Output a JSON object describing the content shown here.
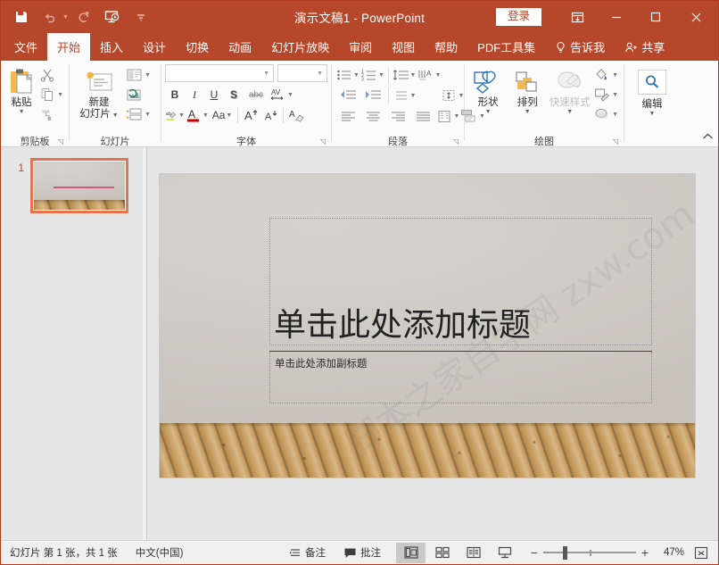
{
  "titlebar": {
    "document_title": "演示文稿1",
    "app_name": "PowerPoint",
    "title_full": "演示文稿1 - PowerPoint",
    "signin_label": "登录",
    "brand_color": "#b7472a",
    "quick_access": [
      {
        "name": "save-icon",
        "label": "保存",
        "disabled": false
      },
      {
        "name": "undo-icon",
        "label": "撤消",
        "disabled": true
      },
      {
        "name": "redo-icon",
        "label": "恢复",
        "disabled": true
      },
      {
        "name": "start-slideshow-icon",
        "label": "从头开始",
        "disabled": false
      },
      {
        "name": "customize-qat-icon",
        "label": "自定义快速访问工具栏",
        "disabled": false
      }
    ],
    "window_buttons": [
      {
        "name": "ribbon-display-options-icon",
        "glyph": "▣"
      },
      {
        "name": "minimize-button",
        "glyph": "—"
      },
      {
        "name": "maximize-button",
        "glyph": "▢"
      },
      {
        "name": "close-button",
        "glyph": "✕"
      }
    ]
  },
  "tabs": [
    {
      "label": "文件",
      "active": false
    },
    {
      "label": "开始",
      "active": true
    },
    {
      "label": "插入",
      "active": false
    },
    {
      "label": "设计",
      "active": false
    },
    {
      "label": "切换",
      "active": false
    },
    {
      "label": "动画",
      "active": false
    },
    {
      "label": "幻灯片放映",
      "active": false
    },
    {
      "label": "审阅",
      "active": false
    },
    {
      "label": "视图",
      "active": false
    },
    {
      "label": "帮助",
      "active": false
    },
    {
      "label": "PDF工具集",
      "active": false
    },
    {
      "label": "告诉我",
      "active": false,
      "icon": "lightbulb-icon"
    },
    {
      "label": "共享",
      "active": false,
      "icon": "share-person-icon"
    }
  ],
  "ribbon": {
    "groups": [
      {
        "name": "clipboard",
        "label": "剪贴板",
        "paste_label": "粘贴",
        "small_buttons": [
          {
            "name": "cut-icon",
            "label": "剪切"
          },
          {
            "name": "copy-icon",
            "label": "复制"
          },
          {
            "name": "format-painter-icon",
            "label": "格式刷"
          }
        ]
      },
      {
        "name": "slides",
        "label": "幻灯片",
        "new_slide_label_line1": "新建",
        "new_slide_label_line2": "幻灯片",
        "small_buttons": [
          {
            "name": "layout-icon",
            "label": "版式"
          },
          {
            "name": "reset-icon",
            "label": "重置"
          },
          {
            "name": "section-icon",
            "label": "节"
          }
        ]
      },
      {
        "name": "font",
        "label": "字体",
        "font_name_value": "",
        "font_name_placeholder": "",
        "font_size_value": "",
        "font_size_placeholder": "",
        "buttons": [
          {
            "name": "bold-button",
            "glyph": "B"
          },
          {
            "name": "italic-button",
            "glyph": "I"
          },
          {
            "name": "underline-button",
            "glyph": "U"
          },
          {
            "name": "shadow-button",
            "glyph": "S"
          },
          {
            "name": "strikethrough-button",
            "glyph": "abc"
          },
          {
            "name": "character-spacing-button",
            "glyph": "AV"
          },
          {
            "name": "text-highlight-button",
            "glyph": "ab"
          },
          {
            "name": "font-color-button",
            "glyph": "A"
          },
          {
            "name": "change-case-button",
            "glyph": "Aa"
          },
          {
            "name": "increase-font-size-button",
            "glyph": "A"
          },
          {
            "name": "decrease-font-size-button",
            "glyph": "A"
          },
          {
            "name": "clear-formatting-button",
            "glyph": "A"
          }
        ]
      },
      {
        "name": "paragraph",
        "label": "段落",
        "buttons": [
          {
            "name": "bullets-button"
          },
          {
            "name": "numbering-button"
          },
          {
            "name": "line-spacing-button"
          },
          {
            "name": "text-direction-button"
          },
          {
            "name": "decrease-indent-button"
          },
          {
            "name": "increase-indent-button"
          },
          {
            "name": "paragraph-spacing-button"
          },
          {
            "name": "align-text-button"
          },
          {
            "name": "align-left-button"
          },
          {
            "name": "align-center-button"
          },
          {
            "name": "align-right-button"
          },
          {
            "name": "justify-button"
          },
          {
            "name": "columns-button"
          },
          {
            "name": "convert-to-smartart-button"
          }
        ]
      },
      {
        "name": "drawing",
        "label": "绘图",
        "shapes_label": "形状",
        "arrange_label": "排列",
        "quickstyles_label": "快速样式",
        "quickstyles_disabled": true,
        "small_buttons": [
          {
            "name": "shape-fill-icon",
            "label": "形状填充"
          },
          {
            "name": "shape-outline-icon",
            "label": "形状轮廓"
          },
          {
            "name": "shape-effects-icon",
            "label": "形状效果"
          }
        ]
      },
      {
        "name": "editing",
        "label": "",
        "find_label": "编辑"
      }
    ],
    "collapse_ribbon_icon": "chevron-up-icon"
  },
  "thumbnails": {
    "slides": [
      {
        "number": "1",
        "selected": true
      }
    ]
  },
  "slide": {
    "title_placeholder": "单击此处添加标题",
    "subtitle_placeholder": "单击此处添加副标题",
    "watermark_text": "脚本之家自学网 zxw.com",
    "accent_line_color": "#9e1b2f"
  },
  "statusbar": {
    "slide_count_text": "幻灯片 第 1 张，共 1 张",
    "language": "中文(中国)",
    "notes_label": "备注",
    "comments_label": "批注",
    "views": [
      {
        "name": "normal-view-button",
        "label": "普通视图",
        "active": true
      },
      {
        "name": "slide-sorter-view-button",
        "label": "幻灯片浏览",
        "active": false
      },
      {
        "name": "reading-view-button",
        "label": "阅读视图",
        "active": false
      },
      {
        "name": "slideshow-view-button",
        "label": "幻灯片放映",
        "active": false
      }
    ],
    "zoom_minus": "−",
    "zoom_plus": "+",
    "zoom_value": "47%",
    "fit_label": "使幻灯片适应当前窗口"
  }
}
